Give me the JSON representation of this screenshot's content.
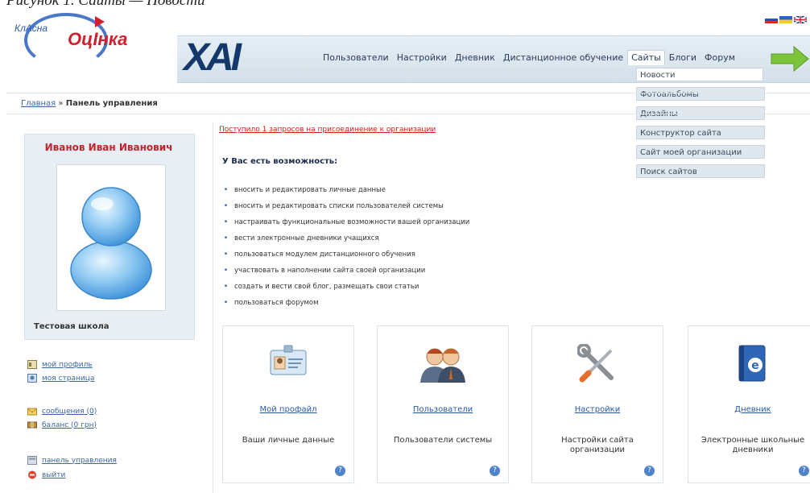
{
  "top_caption": "Рисунок 1. Сайты — Новости",
  "logo": {
    "word1": "КлАсна",
    "word2": "ОцІнка"
  },
  "header": {
    "brand": "ХАІ"
  },
  "nav": {
    "items": [
      "Пользователи",
      "Настройки",
      "Дневник",
      "Дистанционное обучение",
      "Сайты",
      "Блоги",
      "Форум"
    ],
    "active_index": 4
  },
  "dropdown": [
    "Новости",
    "Фотоальбомы",
    "Дизайны",
    "Конструктор сайта",
    "Сайт моей организации",
    "Поиск сайтов"
  ],
  "breadcrumb": {
    "home": "Главная",
    "separator": "»",
    "current": "Панель управления"
  },
  "profile": {
    "name": "Иванов Иван Иванович",
    "school": "Тестовая школа"
  },
  "sidebar_links": [
    {
      "label": "мой профиль",
      "icon": "profile-icon"
    },
    {
      "label": "моя страница",
      "icon": "page-icon"
    },
    {
      "label": "сообщения (0)",
      "icon": "messages-icon"
    },
    {
      "label": "баланс (0 грн)",
      "icon": "balance-icon"
    },
    {
      "label": "панель управления",
      "icon": "control-panel-icon"
    },
    {
      "label": "выйти",
      "icon": "exit-icon"
    }
  ],
  "notice": "Поступило 1 запросов на присоединение к организации",
  "intro": "У Вас есть возможность:",
  "bullets": [
    "вносить и редактировать личные данные",
    "вносить и редактировать списки пользователей системы",
    "настраивать функциональные возможности вашей организации",
    "вести электронные дневники учащихся",
    "пользоваться модулем дистанционного обучения",
    "участвовать в наполнении сайта своей организации",
    "создать и вести свой блог, размещать свои статьи",
    "пользоваться форумом"
  ],
  "cards": [
    {
      "title": "Мой профайл",
      "desc": "Ваши личные данные",
      "icon": "id-card-icon"
    },
    {
      "title": "Пользователи",
      "desc": "Пользователи системы",
      "icon": "users-icon"
    },
    {
      "title": "Настройки",
      "desc": "Настройки сайта организации",
      "icon": "tools-icon"
    },
    {
      "title": "Дневник",
      "desc": "Электронные школьные дневники",
      "icon": "diary-icon"
    }
  ],
  "help_glyph": "?"
}
